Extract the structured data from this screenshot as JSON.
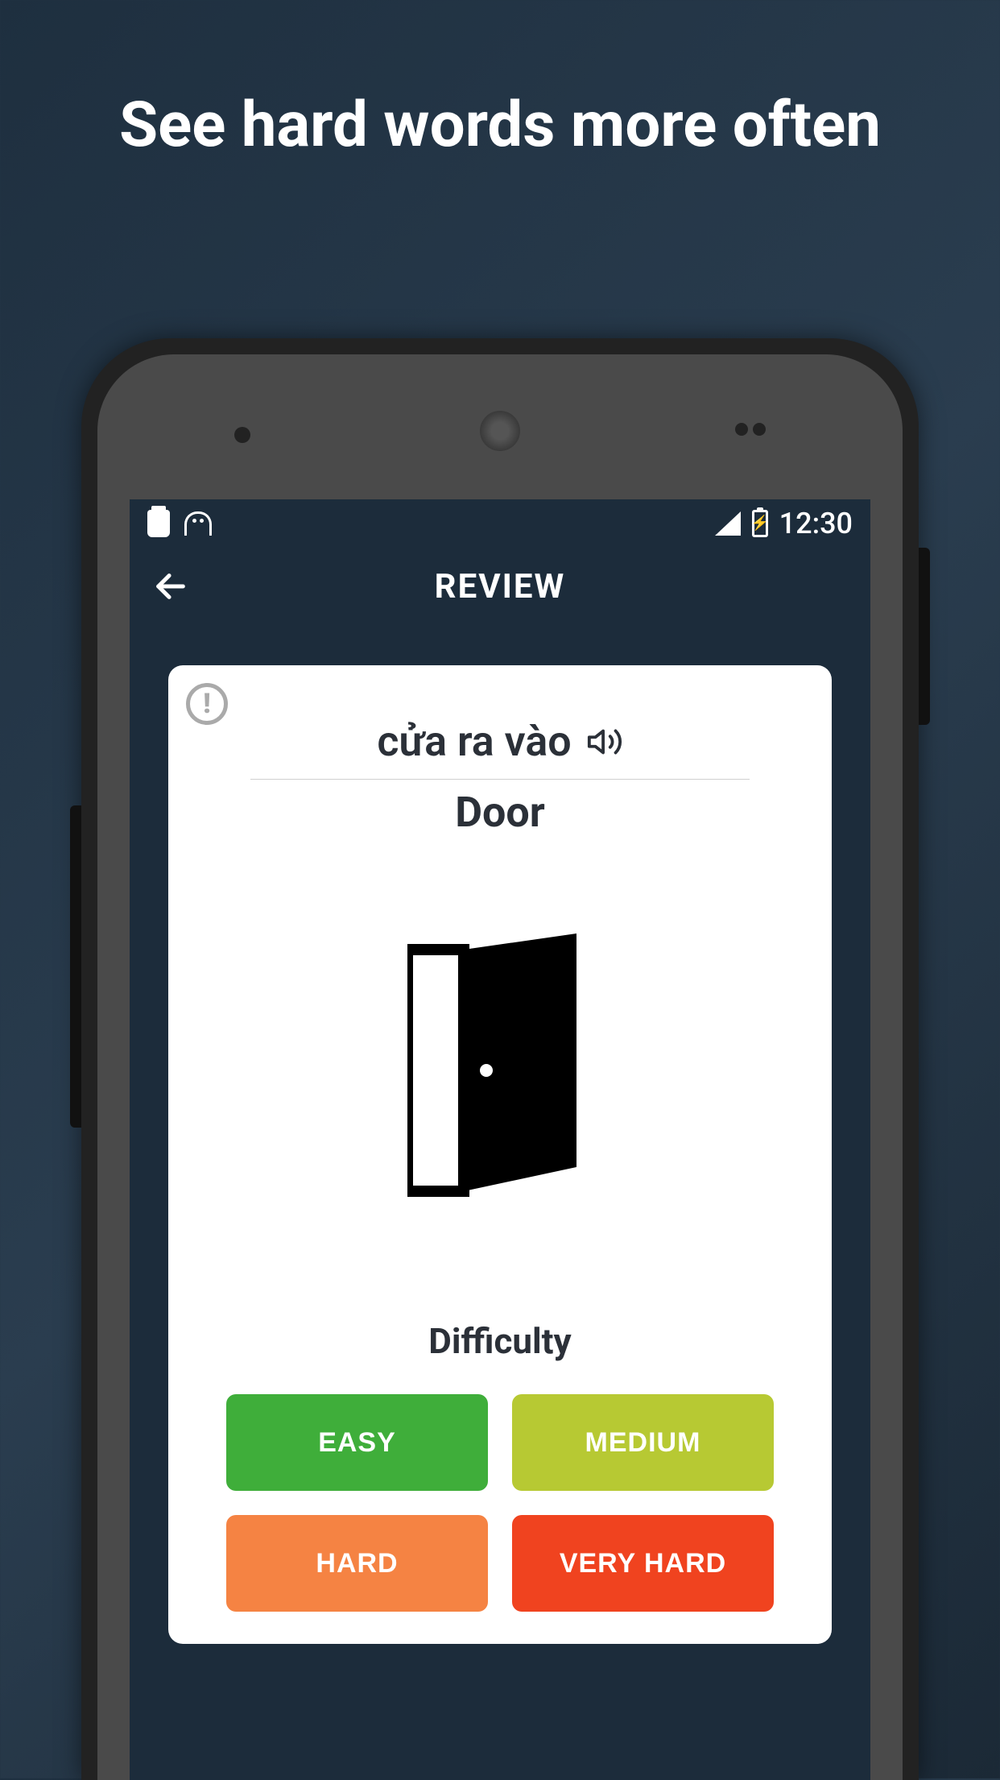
{
  "promo": {
    "title": "See hard words more often"
  },
  "status": {
    "time": "12:30"
  },
  "header": {
    "title": "REVIEW"
  },
  "card": {
    "foreign_word": "cửa ra vào",
    "native_word": "Door",
    "difficulty_label": "Difficulty"
  },
  "buttons": {
    "easy": "EASY",
    "medium": "MEDIUM",
    "hard": "HARD",
    "very_hard": "VERY HARD"
  }
}
